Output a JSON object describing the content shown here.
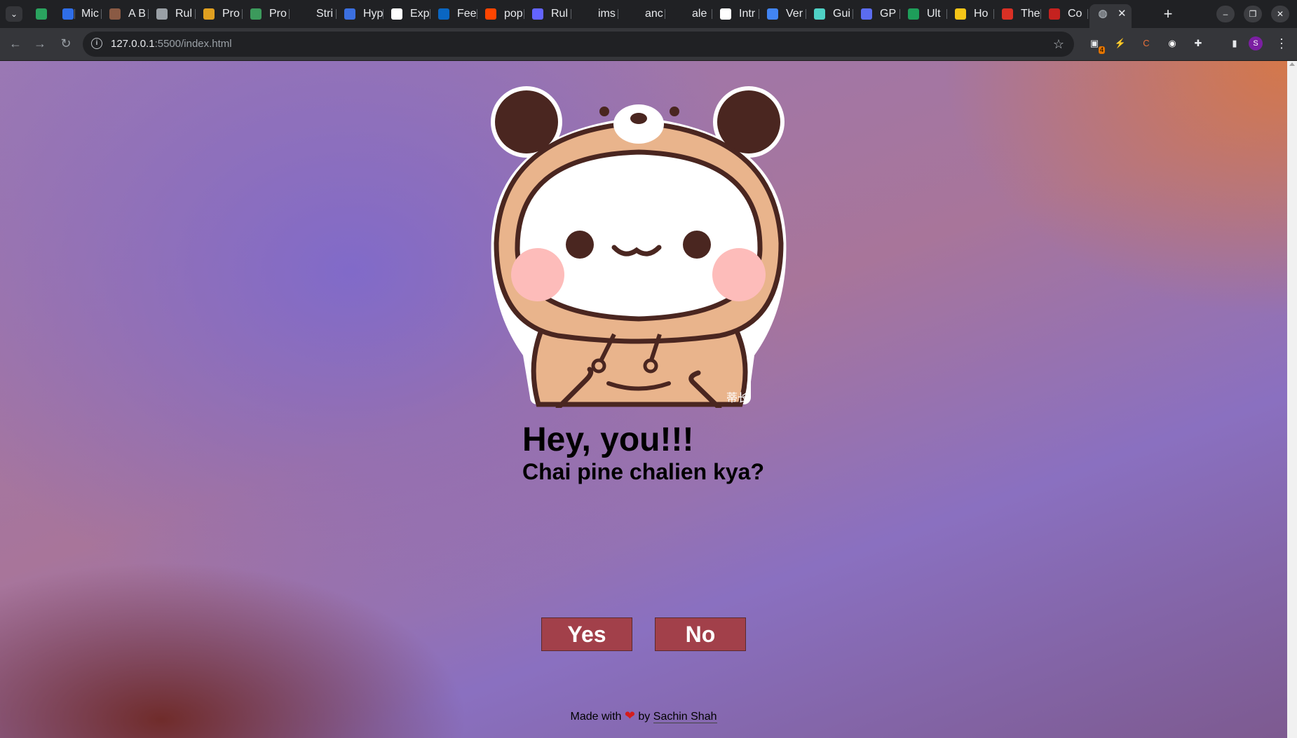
{
  "tabs": [
    {
      "label": "",
      "icon": "multicolor-grid-icon",
      "color": "#2aa35f"
    },
    {
      "label": "Mic",
      "icon": "power-automate-icon",
      "color": "#2f6ee8"
    },
    {
      "label": "A B",
      "icon": "avatar-icon",
      "color": "#8a5a44"
    },
    {
      "label": "Rul",
      "icon": "openai-icon",
      "color": "#9aa0a6"
    },
    {
      "label": "Pro",
      "icon": "ladder-icon",
      "color": "#e0a020"
    },
    {
      "label": "Pro",
      "icon": "infinity-icon",
      "color": "#3c9a5c"
    },
    {
      "label": "Stri",
      "icon": "x-icon",
      "color": "#202124"
    },
    {
      "label": "Hyp",
      "icon": "arrow-icon",
      "color": "#3b6fe0"
    },
    {
      "label": "Exp",
      "icon": "ih-icon",
      "color": "#ffffff"
    },
    {
      "label": "Fee",
      "icon": "linkedin-icon",
      "color": "#0a66c2"
    },
    {
      "label": "pop",
      "icon": "reddit-icon",
      "color": "#ff4500"
    },
    {
      "label": "Rul",
      "icon": "mastodon-icon",
      "color": "#6364ff"
    },
    {
      "label": "ims",
      "icon": "github-icon",
      "color": "#202124"
    },
    {
      "label": "anc",
      "icon": "github-icon",
      "color": "#202124"
    },
    {
      "label": "ale",
      "icon": "github-icon",
      "color": "#202124"
    },
    {
      "label": "Intr",
      "icon": "google-icon",
      "color": "#ffffff"
    },
    {
      "label": "Ver",
      "icon": "cloud-icon",
      "color": "#4285f4"
    },
    {
      "label": "Gui",
      "icon": "shield-icon",
      "color": "#4fd1c5"
    },
    {
      "label": "GP",
      "icon": "ai-icon",
      "color": "#5b6cf0"
    },
    {
      "label": "Ult",
      "icon": "plus-icon",
      "color": "#1e9e5a"
    },
    {
      "label": "Ho",
      "icon": "pacman-icon",
      "color": "#f5c518"
    },
    {
      "label": "The",
      "icon": "figure-icon",
      "color": "#d93025"
    },
    {
      "label": "Co",
      "icon": "red-square-icon",
      "color": "#c5221f"
    }
  ],
  "active_tab": {
    "icon": "globe-icon",
    "close": "✕"
  },
  "new_tab": "+",
  "window": {
    "minimize": "–",
    "restore": "❐",
    "close": "✕"
  },
  "address": {
    "host": "127.0.0.1",
    "rest": ":5500/index.html"
  },
  "extensions": [
    {
      "name": "extension-badge-icon",
      "badge": "4"
    },
    {
      "name": "bolt-extension-icon"
    },
    {
      "name": "c-extension-icon"
    },
    {
      "name": "owl-extension-icon"
    },
    {
      "name": "puzzle-extensions-icon"
    },
    {
      "name": "sidepanel-icon"
    }
  ],
  "profile_initial": "S",
  "page": {
    "title": "Hey, you!!!",
    "subtitle": "Chai pine chalien kya?",
    "yes_label": "Yes",
    "no_label": "No",
    "footer_prefix": "Made with",
    "footer_by": "by",
    "author": "Sachin Shah",
    "watermark": "蒂长"
  },
  "colors": {
    "button_bg": "#a2404a",
    "heart": "#d41c1c",
    "bear_hood": "#e9b48c",
    "bear_outline": "#4a2620"
  }
}
